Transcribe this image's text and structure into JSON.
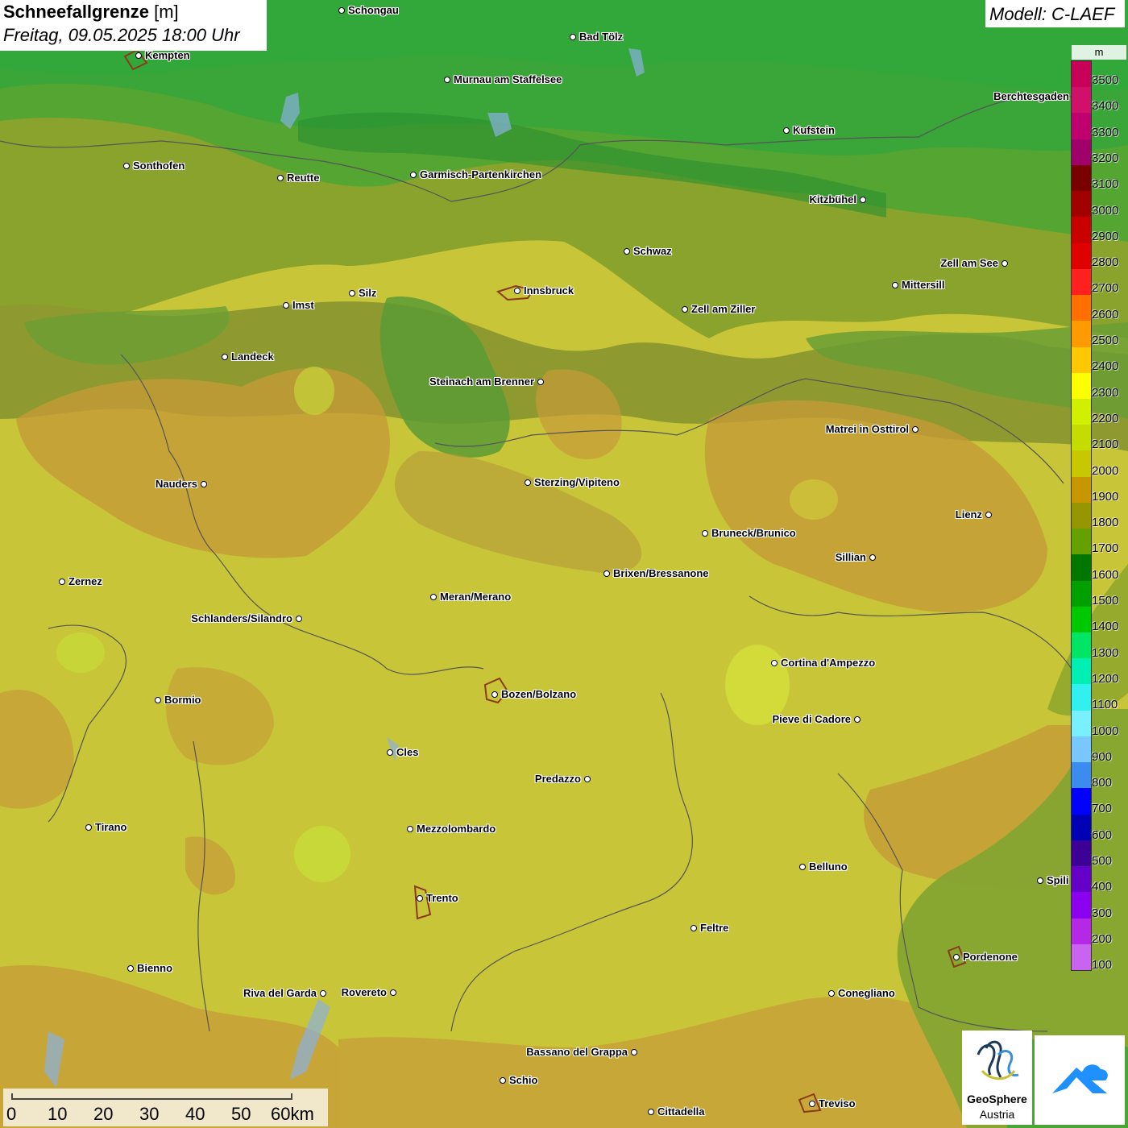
{
  "title": {
    "parameter": "Schneefallgrenze",
    "unit": "[m]",
    "datetime": "Freitag, 09.05.2025 18:00 Uhr"
  },
  "model": "Modell: C-LAEF",
  "legend": {
    "unit": "m",
    "labels": [
      "3500",
      "3400",
      "3300",
      "3200",
      "3100",
      "3000",
      "2900",
      "2800",
      "2700",
      "2600",
      "2500",
      "2400",
      "2300",
      "2200",
      "2100",
      "2000",
      "1900",
      "1800",
      "1700",
      "1600",
      "1500",
      "1400",
      "1300",
      "1200",
      "1100",
      "1000",
      "900",
      "800",
      "700",
      "600",
      "500",
      "400",
      "300",
      "200",
      "100"
    ],
    "colors": [
      "#c8005a",
      "#d0106a",
      "#c0006e",
      "#a0006a",
      "#780000",
      "#a00000",
      "#c80000",
      "#e00000",
      "#ff2020",
      "#ff7000",
      "#ff9a00",
      "#ffc800",
      "#ffff00",
      "#d0f000",
      "#c4dc00",
      "#c8c800",
      "#c89600",
      "#969600",
      "#64a000",
      "#007800",
      "#00a000",
      "#00c800",
      "#00e664",
      "#00f0b4",
      "#32f0f0",
      "#78f0ff",
      "#78c8ff",
      "#3c8cf0",
      "#0000ff",
      "#0000b4",
      "#3c0096",
      "#6400c8",
      "#8c00f0",
      "#b428e6",
      "#c864f0"
    ]
  },
  "cities": [
    {
      "name": "Schongau",
      "side": "right"
    },
    {
      "name": "Bad Tölz",
      "side": "right"
    },
    {
      "name": "Kempten",
      "side": "right"
    },
    {
      "name": "Murnau am Staffelsee",
      "side": "right"
    },
    {
      "name": "Berchtesgaden",
      "side": "left"
    },
    {
      "name": "Kufstein",
      "side": "right"
    },
    {
      "name": "Sonthofen",
      "side": "right"
    },
    {
      "name": "Reutte",
      "side": "right"
    },
    {
      "name": "Garmisch-Partenkirchen",
      "side": "right"
    },
    {
      "name": "Kitzbühel",
      "side": "left"
    },
    {
      "name": "Schwaz",
      "side": "right"
    },
    {
      "name": "Zell am See",
      "side": "left"
    },
    {
      "name": "Innsbruck",
      "side": "right"
    },
    {
      "name": "Silz",
      "side": "right"
    },
    {
      "name": "Mittersill",
      "side": "right"
    },
    {
      "name": "Imst",
      "side": "right"
    },
    {
      "name": "Zell am Ziller",
      "side": "right"
    },
    {
      "name": "Landeck",
      "side": "right"
    },
    {
      "name": "Steinach am Brenner",
      "side": "left"
    },
    {
      "name": "Matrei in Osttirol",
      "side": "left"
    },
    {
      "name": "Nauders",
      "side": "left"
    },
    {
      "name": "Sterzing/Vipiteno",
      "side": "right"
    },
    {
      "name": "Lienz",
      "side": "left"
    },
    {
      "name": "Bruneck/Brunico",
      "side": "right"
    },
    {
      "name": "Sillian",
      "side": "left"
    },
    {
      "name": "Brixen/Bressanone",
      "side": "right"
    },
    {
      "name": "Zernez",
      "side": "right"
    },
    {
      "name": "Meran/Merano",
      "side": "right"
    },
    {
      "name": "Schlanders/Silandro",
      "side": "left"
    },
    {
      "name": "Cortina d'Ampezzo",
      "side": "right"
    },
    {
      "name": "Bozen/Bolzano",
      "side": "right"
    },
    {
      "name": "Bormio",
      "side": "right"
    },
    {
      "name": "Pieve di Cadore",
      "side": "left"
    },
    {
      "name": "Cles",
      "side": "right"
    },
    {
      "name": "Predazzo",
      "side": "left"
    },
    {
      "name": "Tirano",
      "side": "right"
    },
    {
      "name": "Mezzolombardo",
      "side": "right"
    },
    {
      "name": "Belluno",
      "side": "right"
    },
    {
      "name": "Spili",
      "side": "right"
    },
    {
      "name": "Trento",
      "side": "right"
    },
    {
      "name": "Feltre",
      "side": "right"
    },
    {
      "name": "Pordenone",
      "side": "right"
    },
    {
      "name": "Bienno",
      "side": "right"
    },
    {
      "name": "Riva del Garda",
      "side": "left"
    },
    {
      "name": "Rovereto",
      "side": "left"
    },
    {
      "name": "Conegliano",
      "side": "right"
    },
    {
      "name": "Bassano del Grappa",
      "side": "left"
    },
    {
      "name": "Schio",
      "side": "right"
    },
    {
      "name": "Treviso",
      "side": "right"
    },
    {
      "name": "Cittadella",
      "side": "right"
    }
  ],
  "scale": {
    "labels": [
      "0",
      "10",
      "20",
      "30",
      "40",
      "50",
      "60km"
    ]
  },
  "logos": {
    "geosphere_line1": "GeoSphere",
    "geosphere_line2": "Austria"
  }
}
